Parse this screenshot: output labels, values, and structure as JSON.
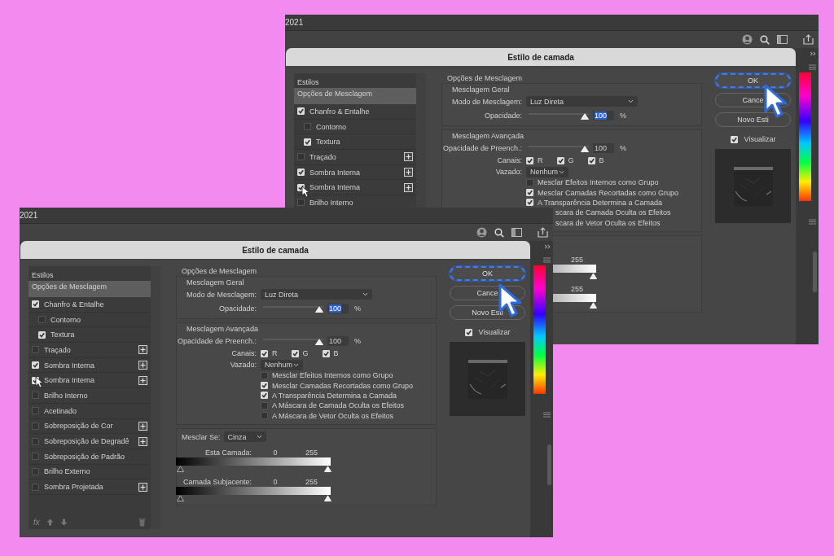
{
  "windows": [
    {
      "year": "2021",
      "dialog": {
        "title": "Estilo de camada",
        "styles_header": "Estilos",
        "styles": [
          {
            "label": "Opções de Mesclagem",
            "kind": "options",
            "selected": true,
            "add_button": false
          },
          {
            "label": "Chanfro & Entalhe",
            "kind": "effect",
            "selected": false,
            "checked": true,
            "add_button": false,
            "children": [
              {
                "label": "Contorno",
                "kind": "effect",
                "selected": false,
                "checked": false,
                "add_button": false
              },
              {
                "label": "Textura",
                "kind": "effect",
                "selected": false,
                "checked": true,
                "add_button": false
              }
            ]
          },
          {
            "label": "Traçado",
            "kind": "effect",
            "selected": false,
            "checked": false,
            "add_button": true
          },
          {
            "label": "Sombra Interna",
            "kind": "effect",
            "selected": false,
            "checked": true,
            "add_button": true
          },
          {
            "label": "Sombra Interna",
            "kind": "effect",
            "selected": false,
            "checked": true,
            "add_button": true
          },
          {
            "label": "Brilho Interno",
            "kind": "effect",
            "selected": false,
            "checked": false,
            "add_button": false
          }
        ],
        "blending": {
          "title": "Opções de Mesclagem",
          "general": {
            "title": "Mesclagem Geral",
            "mode_label": "Modo de Mesclagem:",
            "mode": "Luz Direta",
            "opacity_label": "Opacidade:",
            "opacity": {
              "level": 1,
              "value": "100",
              "unit": "%",
              "highlighted": true
            }
          },
          "advanced": {
            "title": "Mesclagem Avançada",
            "fill_label": "Opacidade de Preench.:",
            "fill": {
              "level": 1,
              "value": "100",
              "unit": "%",
              "highlighted": false
            },
            "channels_label": "Canais:",
            "channels": [
              {
                "label": "R",
                "checked": true
              },
              {
                "label": "G",
                "checked": true
              },
              {
                "label": "B",
                "checked": true
              }
            ],
            "knockout_label": "Vazado:",
            "knockout": "Nenhum",
            "options": [
              {
                "label": "Mesclar Efeitos Internos como Grupo",
                "checked": false
              },
              {
                "label": "Mesclar Camadas Recortadas como Grupo",
                "checked": true
              },
              {
                "label": "A Transparência Determina a Camada",
                "checked": true
              },
              {
                "label": "scara de Camada Oculta os Efeitos"
              },
              {
                "label": "scara de Vetor Oculta os Efeitos"
              }
            ]
          },
          "blend_if": {
            "sliders": [
              {
                "max": "255"
              },
              {
                "max": "255"
              }
            ]
          }
        },
        "buttons": [
          {
            "label": "OK",
            "focused": true
          },
          {
            "label": "Cance",
            "focused": false
          },
          {
            "label": "Novo Esti",
            "focused": false
          }
        ],
        "preview": {
          "label": "Visualizar",
          "checked": true
        }
      }
    },
    {
      "year": "2021",
      "dialog": {
        "title": "Estilo de camada",
        "styles_header": "Estilos",
        "styles": [
          {
            "label": "Opções de Mesclagem",
            "kind": "options",
            "selected": true,
            "add_button": false
          },
          {
            "label": "Chanfro & Entalhe",
            "kind": "effect",
            "selected": false,
            "checked": true,
            "add_button": false,
            "children": [
              {
                "label": "Contorno",
                "kind": "effect",
                "selected": false,
                "checked": false,
                "add_button": false
              },
              {
                "label": "Textura",
                "kind": "effect",
                "selected": false,
                "checked": true,
                "add_button": false
              }
            ]
          },
          {
            "label": "Traçado",
            "kind": "effect",
            "selected": false,
            "checked": false,
            "add_button": true
          },
          {
            "label": "Sombra Interna",
            "kind": "effect",
            "selected": false,
            "checked": true,
            "add_button": true
          },
          {
            "label": "Sombra Interna",
            "kind": "effect",
            "selected": false,
            "checked": true,
            "add_button": true
          },
          {
            "label": "Brilho Interno",
            "kind": "effect",
            "selected": false,
            "checked": false,
            "add_button": false
          },
          {
            "label": "Acetinado",
            "kind": "effect",
            "selected": false,
            "checked": false,
            "add_button": false
          },
          {
            "label": "Sobreposição de Cor",
            "kind": "effect",
            "selected": false,
            "checked": false,
            "add_button": true
          },
          {
            "label": "Sobreposição de Degradê",
            "kind": "effect",
            "selected": false,
            "checked": false,
            "add_button": true
          },
          {
            "label": "Sobreposição de Padrão",
            "kind": "effect",
            "selected": false,
            "checked": false,
            "add_button": false
          },
          {
            "label": "Brilho Externo",
            "kind": "effect",
            "selected": false,
            "checked": false,
            "add_button": false
          },
          {
            "label": "Sombra Projetada",
            "kind": "effect",
            "selected": false,
            "checked": false,
            "add_button": true
          }
        ],
        "footer_fx": "fx",
        "blending": {
          "title": "Opções de Mesclagem",
          "general": {
            "title": "Mesclagem Geral",
            "mode_label": "Modo de Mesclagem:",
            "mode": "Luz Direta",
            "opacity_label": "Opacidade:",
            "opacity": {
              "level": 1,
              "value": "100",
              "unit": "%",
              "highlighted": true
            }
          },
          "advanced": {
            "title": "Mesclagem Avançada",
            "fill_label": "Opacidade de Preench.:",
            "fill": {
              "level": 1,
              "value": "100",
              "unit": "%",
              "highlighted": false
            },
            "channels_label": "Canais:",
            "channels": [
              {
                "label": "R",
                "checked": true
              },
              {
                "label": "G",
                "checked": true
              },
              {
                "label": "B",
                "checked": true
              }
            ],
            "knockout_label": "Vazado:",
            "knockout": "Nenhum",
            "options": [
              {
                "label": "Mesclar Efeitos Internos como Grupo",
                "checked": false
              },
              {
                "label": "Mesclar Camadas Recortadas como Grupo",
                "checked": true
              },
              {
                "label": "A Transparência Determina a Camada",
                "checked": true
              },
              {
                "label": "A Máscara de Camada Oculta os Efeitos",
                "checked": false
              },
              {
                "label": "A Máscara de Vetor Oculta os Efeitos",
                "checked": false
              }
            ]
          },
          "blend_if": {
            "label": "Mesclar Se:",
            "value": "Cinza",
            "sliders": [
              {
                "label": "Esta Camada:",
                "min": "0",
                "max": "255"
              },
              {
                "label": "Camada Subjacente:",
                "min": "0",
                "max": "255"
              }
            ]
          }
        },
        "buttons": [
          {
            "label": "OK",
            "focused": true
          },
          {
            "label": "Cance",
            "focused": false
          },
          {
            "label": "Novo Esti",
            "focused": false
          }
        ],
        "preview": {
          "label": "Visualizar",
          "checked": true
        }
      }
    }
  ]
}
